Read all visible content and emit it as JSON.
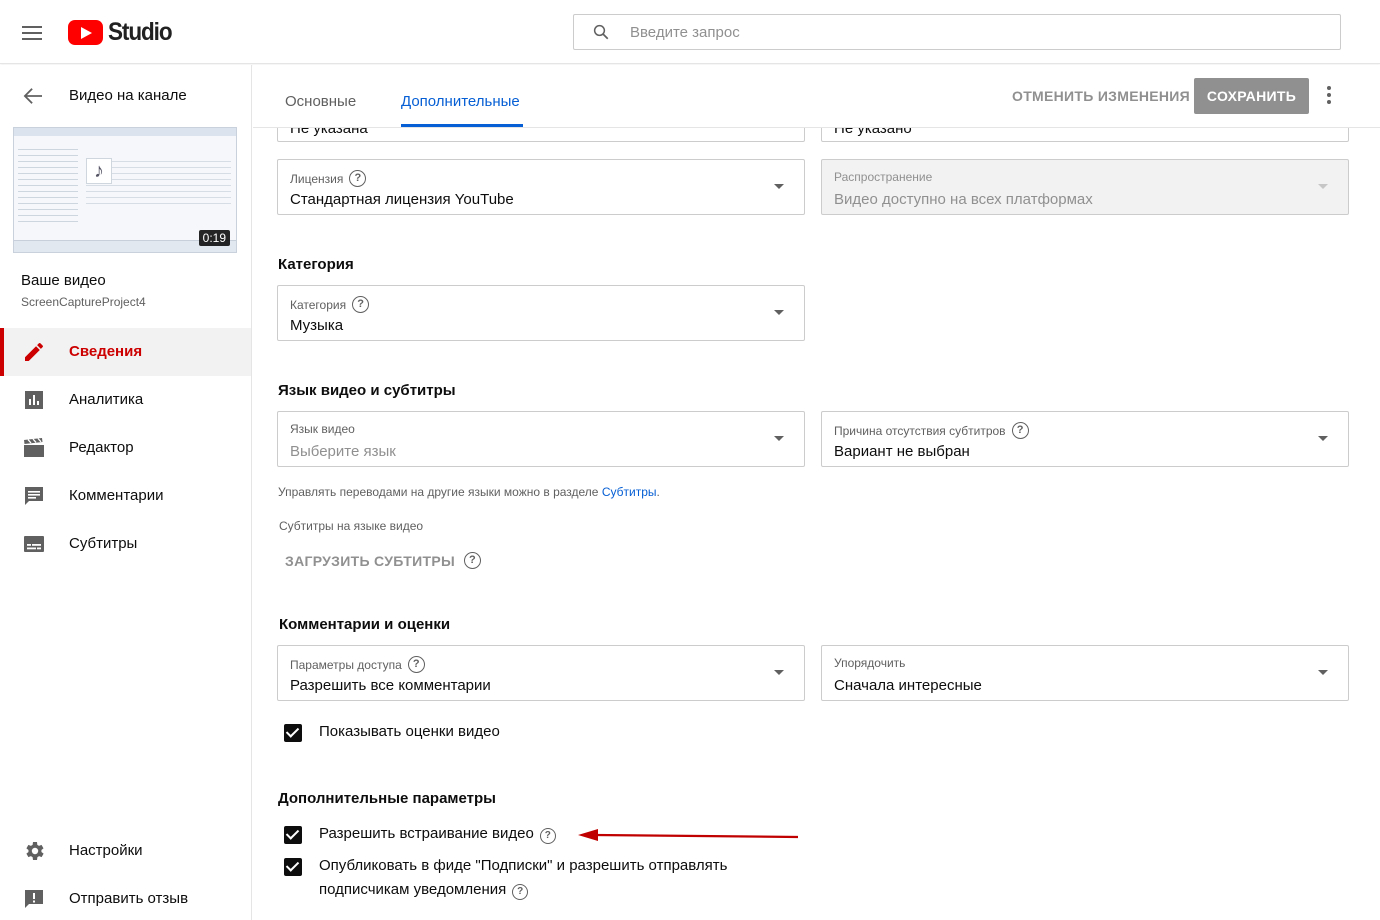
{
  "app": {
    "logo_text": "Studio",
    "brand_color": "#ff0000"
  },
  "search": {
    "placeholder": "Введите запрос"
  },
  "sidebar": {
    "back_label": "Видео на канале",
    "thumbnail_duration": "0:19",
    "video_title": "Ваше видео",
    "video_name": "ScreenCaptureProject4",
    "nav": [
      {
        "label": "Сведения",
        "icon": "pencil-icon",
        "active": true
      },
      {
        "label": "Аналитика",
        "icon": "analytics-icon",
        "active": false
      },
      {
        "label": "Редактор",
        "icon": "clapperboard-icon",
        "active": false
      },
      {
        "label": "Комментарии",
        "icon": "comment-icon",
        "active": false
      },
      {
        "label": "Субтитры",
        "icon": "subtitles-icon",
        "active": false
      }
    ],
    "bottom_nav": [
      {
        "label": "Настройки",
        "icon": "gear-icon"
      },
      {
        "label": "Отправить отзыв",
        "icon": "feedback-icon"
      }
    ]
  },
  "header": {
    "tabs": [
      {
        "label": "Основные",
        "active": false
      },
      {
        "label": "Дополнительные",
        "active": true
      }
    ],
    "cancel_label": "ОТМЕНИТЬ ИЗМЕНЕНИЯ",
    "save_label": "СОХРАНИТЬ",
    "accent_color": "#065fd4"
  },
  "form": {
    "top_partial_left": "Не указана",
    "top_partial_right": "Не указано",
    "license": {
      "label": "Лицензия",
      "value": "Стандартная лицензия YouTube"
    },
    "distribution": {
      "label": "Распространение",
      "value": "Видео доступно на всех платформах"
    },
    "category_section": "Категория",
    "category": {
      "label": "Категория",
      "value": "Музыка"
    },
    "language_section": "Язык видео и субтитры",
    "video_language": {
      "label": "Язык видео",
      "value": "Выберите язык"
    },
    "no_subs_reason": {
      "label": "Причина отсутствия субтитров",
      "value": "Вариант не выбран"
    },
    "translations_hint": "Управлять переводами на другие языки можно в разделе ",
    "translations_link": "Субтитры",
    "translations_hint_end": ".",
    "subs_in_video_lang": "Субтитры на языке видео",
    "upload_subs": "ЗАГРУЗИТЬ СУБТИТРЫ",
    "comments_section": "Комментарии и оценки",
    "access": {
      "label": "Параметры доступа",
      "value": "Разрешить все комментарии"
    },
    "sort": {
      "label": "Упорядочить",
      "value": "Сначала интересные"
    },
    "show_ratings": {
      "label": "Показывать оценки видео",
      "checked": true
    },
    "extra_section": "Дополнительные параметры",
    "allow_embed": {
      "label": "Разрешить встраивание видео",
      "checked": true
    },
    "publish_feed": {
      "label_line1": "Опубликовать в фиде \"Подписки\" и разрешить отправлять",
      "label_line2": "подписчикам уведомления",
      "checked": true
    }
  },
  "annotation_color": "#c00000"
}
